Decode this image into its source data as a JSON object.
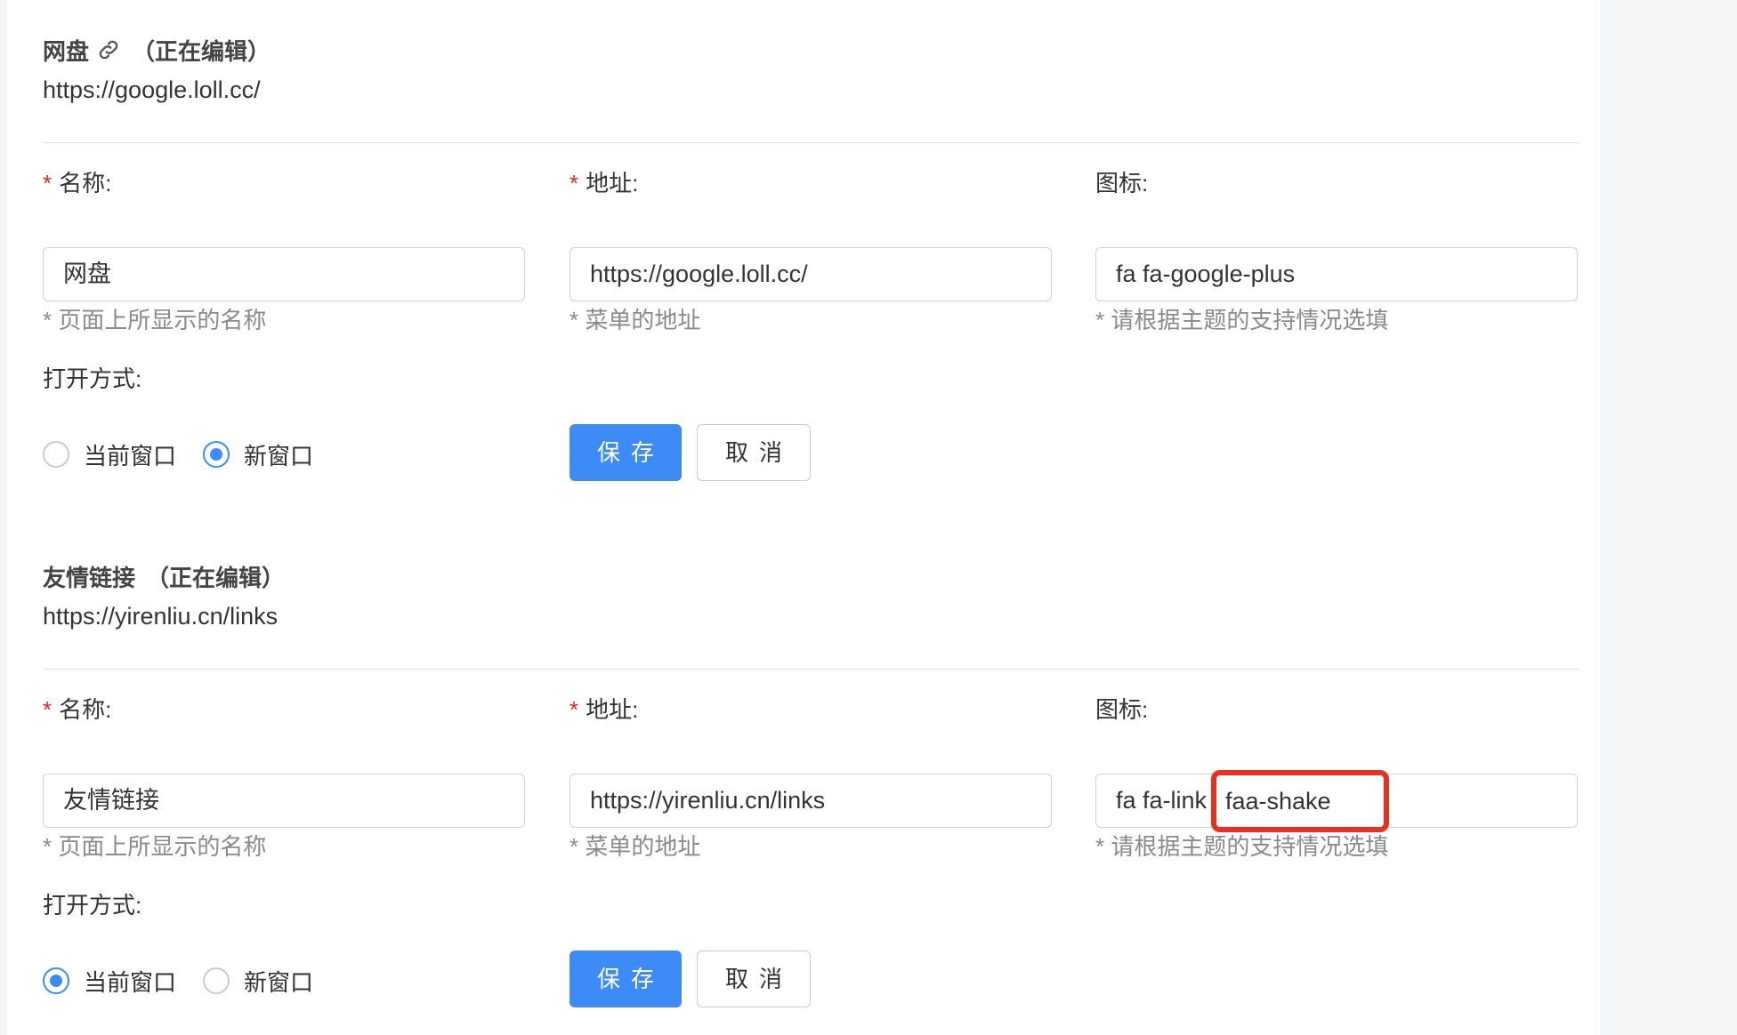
{
  "items": [
    {
      "name": "网盘",
      "editing": "（正在编辑）",
      "url": "https://google.loll.cc/",
      "fields": {
        "name_label": "名称:",
        "name_value": "网盘",
        "name_hint": "* 页面上所显示的名称",
        "url_label": "地址:",
        "url_value": "https://google.loll.cc/",
        "url_hint": "* 菜单的地址",
        "icon_label": "图标:",
        "icon_value": "fa fa-google-plus",
        "icon_hint": "* 请根据主题的支持情况选填"
      },
      "open_label": "打开方式:",
      "open_options": [
        "当前窗口",
        "新窗口"
      ],
      "open_selected": "新窗口",
      "save_label": "保存",
      "cancel_label": "取消"
    },
    {
      "name": "友情链接",
      "editing": "（正在编辑）",
      "url": "https://yirenliu.cn/links",
      "fields": {
        "name_label": "名称:",
        "name_value": "友情链接",
        "name_hint": "* 页面上所显示的名称",
        "url_label": "地址:",
        "url_value": "https://yirenliu.cn/links",
        "url_hint": "* 菜单的地址",
        "icon_label": "图标:",
        "icon_value": "fa fa-link",
        "icon_suffix_highlight": "faa-shake",
        "icon_hint": "* 请根据主题的支持情况选填"
      },
      "open_label": "打开方式:",
      "open_options": [
        "当前窗口",
        "新窗口"
      ],
      "open_selected": "当前窗口",
      "save_label": "保存",
      "cancel_label": "取消"
    }
  ],
  "colors": {
    "primary": "#3d8bf6",
    "required": "#e0261f",
    "highlight": "#e8321f"
  },
  "icons": {
    "title_link": "link-icon"
  }
}
